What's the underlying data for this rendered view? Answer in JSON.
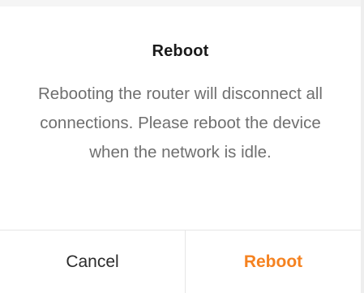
{
  "dialog": {
    "title": "Reboot",
    "message": "Rebooting the router will disconnect all connections. Please reboot the device when the network is idle.",
    "cancel_label": "Cancel",
    "confirm_label": "Reboot"
  },
  "colors": {
    "accent": "#f58220",
    "title_text": "#1a1a1a",
    "body_text": "#6f6f6f",
    "divider": "#e6e6e6"
  }
}
